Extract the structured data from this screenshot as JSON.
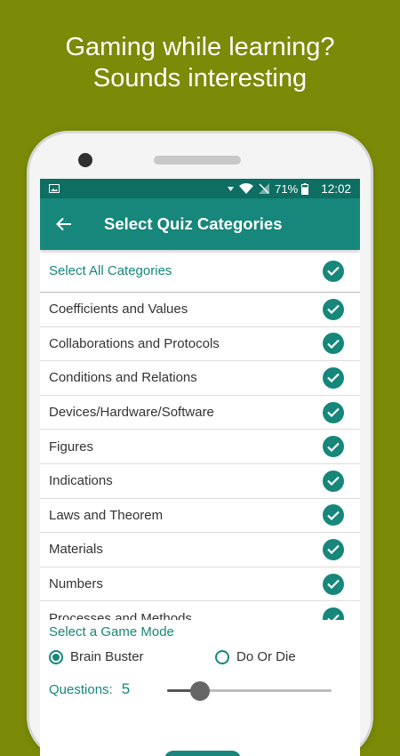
{
  "promo": {
    "line1": "Gaming while learning?",
    "line2": "Sounds interesting"
  },
  "status": {
    "battery": "71%",
    "time": "12:02",
    "icons": [
      "image-icon",
      "signal-down-icon",
      "wifi-icon",
      "no-sim-icon",
      "battery-icon"
    ]
  },
  "appbar": {
    "title": "Select Quiz Categories",
    "back_icon": "arrow-back-icon"
  },
  "categories": {
    "select_all": "Select All Categories",
    "items": [
      "Coefficients and Values",
      "Collaborations and Protocols",
      "Conditions and Relations",
      "Devices/Hardware/Software",
      "Figures",
      "Indications",
      "Laws and Theorem",
      "Materials",
      "Numbers",
      "Processes and Methods"
    ]
  },
  "game_mode": {
    "title": "Select a Game Mode",
    "options": [
      "Brain Buster",
      "Do Or Die"
    ],
    "selected": "Brain Buster"
  },
  "questions": {
    "label": "Questions:",
    "value": "5",
    "slider_fraction": 0.2
  },
  "colors": {
    "background": "#7b8a07",
    "primary": "#16877a",
    "primary_dark": "#0e6e62"
  }
}
